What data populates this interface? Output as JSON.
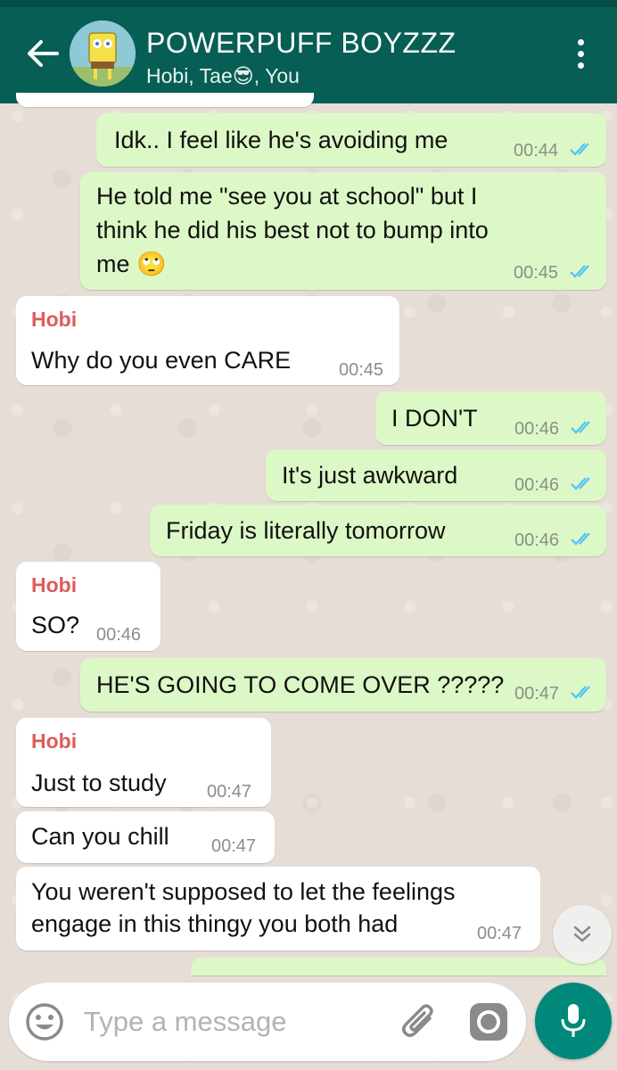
{
  "header": {
    "title": "POWERPUFF BOYZZZ",
    "subtitle": "Hobi, Tae😎, You"
  },
  "messages": [
    {
      "type": "out",
      "text": "Idk.. I feel like he's avoiding me",
      "time": "00:44"
    },
    {
      "type": "out",
      "lines": [
        "He told me \"see you at school\" but I",
        "think he did his best not to bump into",
        "me 🙄"
      ],
      "time": "00:45"
    },
    {
      "type": "in",
      "sender": "Hobi",
      "text": "Why do you even CARE",
      "time": "00:45"
    },
    {
      "type": "out",
      "text": "I DON'T",
      "time": "00:46"
    },
    {
      "type": "out",
      "text": "It's just awkward",
      "time": "00:46"
    },
    {
      "type": "out",
      "text": "Friday is literally tomorrow",
      "time": "00:46"
    },
    {
      "type": "in",
      "sender": "Hobi",
      "text": "SO?",
      "time": "00:46"
    },
    {
      "type": "out",
      "text": "HE'S GOING TO COME OVER ?????",
      "time": "00:47"
    },
    {
      "type": "in",
      "sender": "Hobi",
      "text": "Just to study",
      "time": "00:47"
    },
    {
      "type": "in",
      "text": "Can you chill",
      "time": "00:47"
    },
    {
      "type": "in",
      "lines": [
        "You weren't supposed to let the feelings",
        "engage in this thingy you both had"
      ],
      "time": "00:47"
    }
  ],
  "input": {
    "placeholder": "Type a message"
  },
  "icons": {
    "back": "back-arrow-icon",
    "menu": "more-vert-icon",
    "emoji": "emoji-icon",
    "attach": "paperclip-icon",
    "camera": "camera-icon",
    "mic": "mic-icon",
    "scroll": "chevron-double-down-icon",
    "read_receipt": "double-check-icon"
  },
  "colors": {
    "header": "#075e54",
    "outgoing_bubble": "#dcf8c6",
    "incoming_bubble": "#ffffff",
    "sender_name": "#e05a5a",
    "read_ticks": "#4fc3f7",
    "mic_button": "#00897b"
  }
}
